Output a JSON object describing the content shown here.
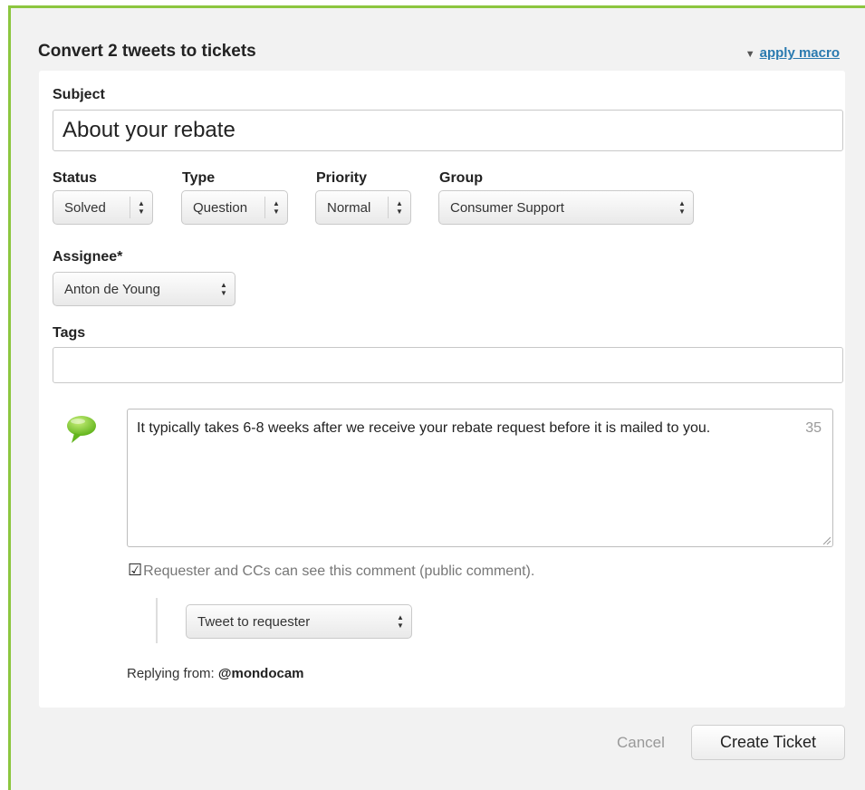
{
  "header": {
    "title": "Convert 2 tweets to tickets",
    "apply_macro": "apply macro"
  },
  "subject": {
    "label": "Subject",
    "value": "About your rebate"
  },
  "status": {
    "label": "Status",
    "value": "Solved"
  },
  "type": {
    "label": "Type",
    "value": "Question"
  },
  "priority": {
    "label": "Priority",
    "value": "Normal"
  },
  "group": {
    "label": "Group",
    "value": "Consumer Support"
  },
  "assignee": {
    "label": "Assignee*",
    "value": "Anton de Young"
  },
  "tags": {
    "label": "Tags",
    "value": ""
  },
  "comment": {
    "text": "It typically takes 6-8 weeks after we receive your rebate request before it is mailed to you.",
    "char_counter": "35",
    "public_label": "Requester and CCs can see this comment (public comment).",
    "public_checked": true
  },
  "tweet_option": {
    "value": "Tweet to requester"
  },
  "replying": {
    "label": "Replying from:",
    "handle": "@mondocam"
  },
  "footer": {
    "cancel": "Cancel",
    "create": "Create Ticket"
  },
  "colors": {
    "frame_border": "#8cc63f",
    "link": "#2a7ab0",
    "bubble": "#7dc242"
  }
}
